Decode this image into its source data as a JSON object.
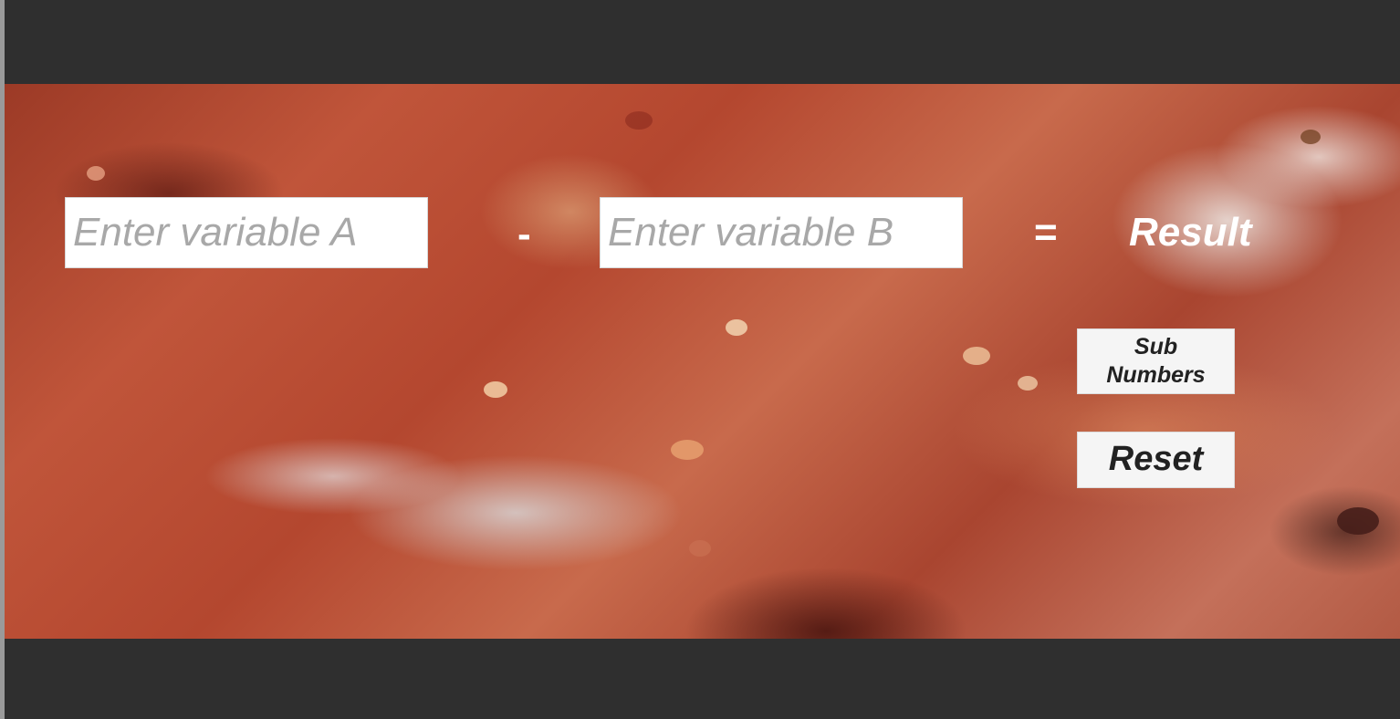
{
  "calculator": {
    "input_a_placeholder": "Enter variable A",
    "input_b_placeholder": "Enter variable B",
    "operator": "-",
    "equals": "=",
    "result": "Result",
    "sub_button_label": "Sub Numbers",
    "reset_button_label": "Reset"
  },
  "theme": {
    "page_background": "#2f2f2f",
    "text_color": "#ffffff",
    "button_background": "#f5f5f5"
  }
}
